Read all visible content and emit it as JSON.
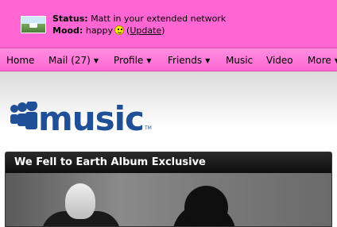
{
  "status": {
    "status_label": "Status:",
    "status_text": "Matt in your extended network",
    "mood_label": "Mood:",
    "mood_text": "happy",
    "update_link": "Update"
  },
  "nav": {
    "items": [
      {
        "label": "Home"
      },
      {
        "label": "Mail (27)",
        "has_menu": true
      },
      {
        "label": "Profile",
        "has_menu": true
      },
      {
        "label": "Friends",
        "has_menu": true
      },
      {
        "label": "Music"
      },
      {
        "label": "Video"
      },
      {
        "label": "More",
        "has_menu": true
      }
    ]
  },
  "brand": {
    "logo_text": "music",
    "trademark": "TM"
  },
  "feature": {
    "title": "We Fell to Earth Album Exclusive"
  },
  "colors": {
    "status_bg": "#ff66d4",
    "logo_blue": "#1f4f96",
    "panel_bg": "#111111"
  },
  "icons": {
    "mood": "smiley-icon",
    "menu_caret": "caret-down-icon",
    "logo_mark": "myspace-people-icon"
  }
}
